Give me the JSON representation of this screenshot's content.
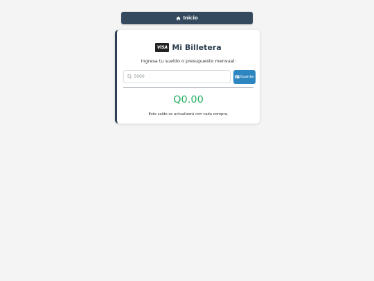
{
  "nav": {
    "home_label": "Inicio",
    "home_icon": "home-icon"
  },
  "wallet": {
    "card_icon": "visa-card-icon",
    "card_brand": "VISA",
    "title": "Mi Billetera",
    "prompt": "Ingresa tu sueldo o presupuesto mensual:",
    "input_value": "",
    "input_placeholder": "Ej: 5000",
    "save_icon": "credit-card-icon",
    "save_label": "Guardar",
    "balance": "Q0.00",
    "note": "Este saldo se actualizará con cada compra."
  },
  "colors": {
    "background": "#f3f4f3",
    "nav_button": "#34495e",
    "card_accent": "#2c3e50",
    "save_button": "#2e86c1",
    "balance_text": "#27ae60"
  }
}
